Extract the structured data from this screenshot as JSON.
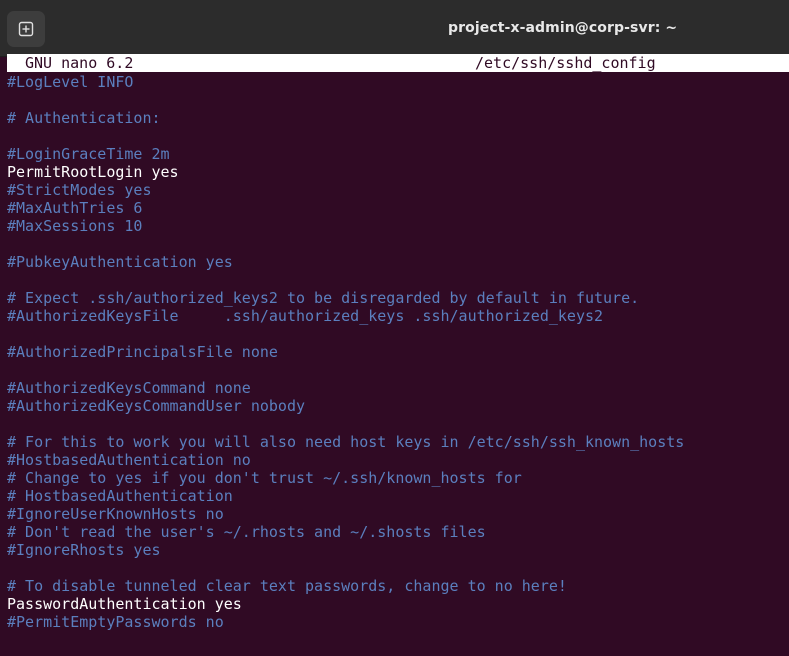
{
  "window": {
    "title": "project-x-admin@corp-svr: ~",
    "new_tab_icon": "new-tab-icon"
  },
  "nano": {
    "version": "GNU nano 6.2",
    "filename": "/etc/ssh/sshd_config"
  },
  "colors": {
    "terminal_bg": "#300a24",
    "comment": "#5b7fbe",
    "text": "#ffffff",
    "titlebar": "#2c2c2c"
  },
  "lines": [
    {
      "text": "#LogLevel INFO",
      "type": "comment"
    },
    {
      "text": "",
      "type": "blank"
    },
    {
      "text": "# Authentication:",
      "type": "comment"
    },
    {
      "text": "",
      "type": "blank"
    },
    {
      "text": "#LoginGraceTime 2m",
      "type": "comment"
    },
    {
      "text": "PermitRootLogin yes",
      "type": "active"
    },
    {
      "text": "#StrictModes yes",
      "type": "comment"
    },
    {
      "text": "#MaxAuthTries 6",
      "type": "comment"
    },
    {
      "text": "#MaxSessions 10",
      "type": "comment"
    },
    {
      "text": "",
      "type": "blank"
    },
    {
      "text": "#PubkeyAuthentication yes",
      "type": "comment"
    },
    {
      "text": "",
      "type": "blank"
    },
    {
      "text": "# Expect .ssh/authorized_keys2 to be disregarded by default in future.",
      "type": "comment"
    },
    {
      "text": "#AuthorizedKeysFile     .ssh/authorized_keys .ssh/authorized_keys2",
      "type": "comment"
    },
    {
      "text": "",
      "type": "blank"
    },
    {
      "text": "#AuthorizedPrincipalsFile none",
      "type": "comment"
    },
    {
      "text": "",
      "type": "blank"
    },
    {
      "text": "#AuthorizedKeysCommand none",
      "type": "comment"
    },
    {
      "text": "#AuthorizedKeysCommandUser nobody",
      "type": "comment"
    },
    {
      "text": "",
      "type": "blank"
    },
    {
      "text": "# For this to work you will also need host keys in /etc/ssh/ssh_known_hosts",
      "type": "comment"
    },
    {
      "text": "#HostbasedAuthentication no",
      "type": "comment"
    },
    {
      "text": "# Change to yes if you don't trust ~/.ssh/known_hosts for",
      "type": "comment"
    },
    {
      "text": "# HostbasedAuthentication",
      "type": "comment"
    },
    {
      "text": "#IgnoreUserKnownHosts no",
      "type": "comment"
    },
    {
      "text": "# Don't read the user's ~/.rhosts and ~/.shosts files",
      "type": "comment"
    },
    {
      "text": "#IgnoreRhosts yes",
      "type": "comment"
    },
    {
      "text": "",
      "type": "blank"
    },
    {
      "text": "# To disable tunneled clear text passwords, change to no here!",
      "type": "comment"
    },
    {
      "text": "PasswordAuthentication yes",
      "type": "active"
    },
    {
      "text": "#PermitEmptyPasswords no",
      "type": "comment"
    }
  ]
}
